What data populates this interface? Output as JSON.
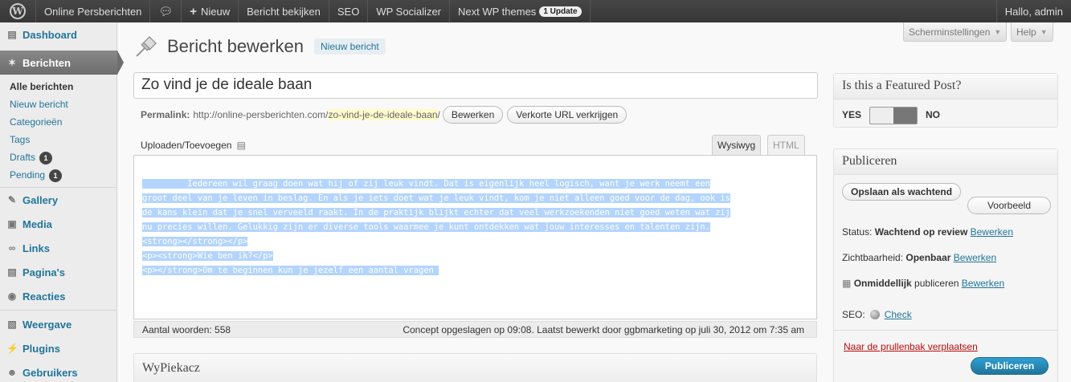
{
  "adminbar": {
    "site": "Online Persberichten",
    "new": "Nieuw",
    "view": "Bericht bekijken",
    "seo": "SEO",
    "socializer": "WP Socializer",
    "themes": "Next WP themes",
    "update": "1 Update",
    "greeting": "Hallo, admin"
  },
  "sidebar": {
    "dashboard": "Dashboard",
    "posts": "Berichten",
    "sub": {
      "all": "Alle berichten",
      "new": "Nieuw bericht",
      "categories": "Categorieën",
      "tags": "Tags",
      "drafts": "Drafts",
      "drafts_count": "1",
      "pending": "Pending",
      "pending_count": "1"
    },
    "gallery": "Gallery",
    "media": "Media",
    "links": "Links",
    "pages": "Pagina's",
    "comments": "Reacties",
    "appearance": "Weergave",
    "plugins": "Plugins",
    "users": "Gebruikers"
  },
  "topbuttons": {
    "screen": "Scherminstellingen",
    "help": "Help"
  },
  "page": {
    "title": "Bericht bewerken",
    "new_post": "Nieuw bericht",
    "post_title": "Zo vind je de ideale baan",
    "permalink_label": "Permalink:",
    "permalink_base": "http://online-persberichten.com/",
    "permalink_slug": "zo-vind-je-de-ideale-baan",
    "permalink_end": "/",
    "edit_btn": "Bewerken",
    "shortlink_btn": "Verkorte URL verkrijgen"
  },
  "editor": {
    "upload": "Uploaden/Toevoegen",
    "tab_visual": "Wysiwyg",
    "tab_html": "HTML",
    "lines": [
      "         Iedereen wil graag doen wat hij of zij leuk vindt. Dat is eigenlijk heel logisch, want je werk neemt een",
      "groot deel van je leven in beslag. En als je iets doet wat je leuk vindt, kom je niet alleen goed voor de dag, ook is",
      "de kans klein dat je snel verveeld raakt. In de praktijk blijkt echter dat veel werkzoekenden niet goed weten wat zij",
      "nu precies willen. Gelukkig zijn er diverse tools waarmee je kunt ontdekken wat jouw interesses en talenten zijn.",
      "<strong></strong></p>",
      "<p><strong>Wie ben ik?</p>",
      "<p></strong>Om te beginnen kun je jezelf een aantal vragen "
    ],
    "word_count": "Aantal woorden: 558",
    "saved": "Concept opgeslagen op 09:08. Laatst bewerkt door ggbmarketing op juli 30, 2012 om 7:35 am"
  },
  "wypiekacz": {
    "title": "WyPiekacz"
  },
  "featured": {
    "title": "Is this a Featured Post?",
    "yes": "YES",
    "no": "NO",
    "value": "NO"
  },
  "publish": {
    "title": "Publiceren",
    "save_pending": "Opslaan als wachtend",
    "preview": "Voorbeeld",
    "status_label": "Status:",
    "status_value": "Wachtend op review",
    "visibility_label": "Zichtbaarheid:",
    "visibility_value": "Openbaar",
    "schedule_value": "Onmiddellijk",
    "schedule_text": "publiceren",
    "edit": "Bewerken",
    "seo_label": "SEO:",
    "seo_check": "Check",
    "trash": "Naar de prullenbak verplaatsen",
    "publish_btn": "Publiceren"
  }
}
